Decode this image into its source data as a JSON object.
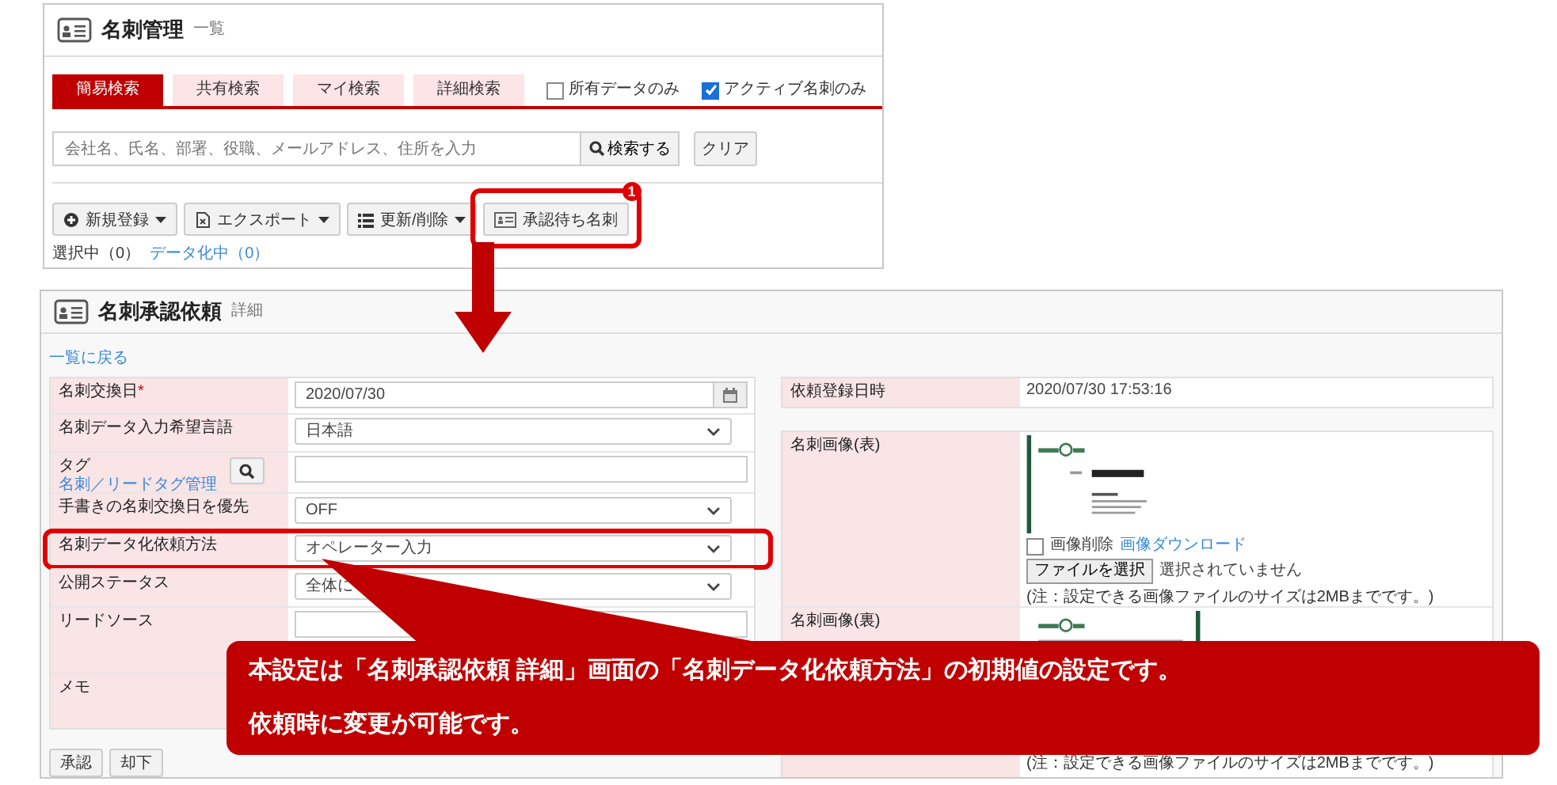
{
  "list_screen": {
    "title": "名刺管理",
    "subtitle": "一覧",
    "tabs": [
      {
        "label": "簡易検索",
        "selected": true
      },
      {
        "label": "共有検索",
        "selected": false
      },
      {
        "label": "マイ検索",
        "selected": false
      },
      {
        "label": "詳細検索",
        "selected": false
      }
    ],
    "filters": [
      {
        "label": "所有データのみ",
        "checked": false
      },
      {
        "label": "アクティブ名刺のみ",
        "checked": true
      }
    ],
    "search": {
      "placeholder": "会社名、氏名、部署、役職、メールアドレス、住所を入力",
      "button": "検索する",
      "clear": "クリア"
    },
    "actions": [
      {
        "label": "新規登録",
        "kind": "dropdown",
        "highlighted": false
      },
      {
        "label": "エクスポート",
        "kind": "dropdown",
        "highlighted": false
      },
      {
        "label": "更新/削除",
        "kind": "dropdown",
        "highlighted": false
      },
      {
        "label": "承認待ち名刺",
        "kind": "plain",
        "badge": "1",
        "highlighted": true
      }
    ],
    "status": [
      {
        "label": "選択中（0）",
        "kind": "text"
      },
      {
        "label": "データ化中（0）",
        "kind": "link"
      }
    ]
  },
  "detail_screen": {
    "title": "名刺承認依頼",
    "subtitle": "詳細",
    "back_link": "一覧に戻る",
    "fields": [
      {
        "label": "名刺交換日",
        "required_mark": "*",
        "kind": "date",
        "value": "2020/07/30",
        "highlighted": false
      },
      {
        "label": "名刺データ入力希望言語",
        "kind": "select",
        "value": "日本語",
        "highlighted": false
      },
      {
        "label": "タグ",
        "link": "名刺／リードタグ管理",
        "kind": "tag",
        "highlighted": false
      },
      {
        "label": "手書きの名刺交換日を優先",
        "kind": "select",
        "value": "OFF",
        "highlighted": false
      },
      {
        "label": "名刺データ化依頼方法",
        "kind": "select",
        "value": "オペレーター入力",
        "highlighted": true
      },
      {
        "label": "公開ステータス",
        "kind": "select",
        "value": "全体に",
        "highlighted": false
      },
      {
        "label": "リードソース",
        "kind": "lead",
        "highlighted": false
      },
      {
        "label": "メモ",
        "kind": "memo",
        "highlighted": false
      }
    ],
    "buttons": [
      "承認",
      "却下"
    ],
    "info": [
      {
        "label": "依頼登録日時",
        "value": "2020/07/30 17:53:16"
      }
    ],
    "images": [
      {
        "label": "名刺画像(表)",
        "kind": "front",
        "delete_label": "画像削除",
        "delete_checked": false,
        "download_link": "画像ダウンロード",
        "file_button": "ファイルを選択",
        "file_status": "選択されていません",
        "note": "(注：設定できる画像ファイルのサイズは2MBまでです。)"
      },
      {
        "label": "名刺画像(裏)",
        "kind": "back",
        "note": "(注：設定できる画像ファイルのサイズは2MBまでです。)"
      }
    ]
  },
  "callout": {
    "lines": [
      "本設定は「名刺承認依頼 詳細」画面の「名刺データ化依頼方法」の初期値の設定です。",
      "依頼時に変更が可能です。"
    ]
  }
}
